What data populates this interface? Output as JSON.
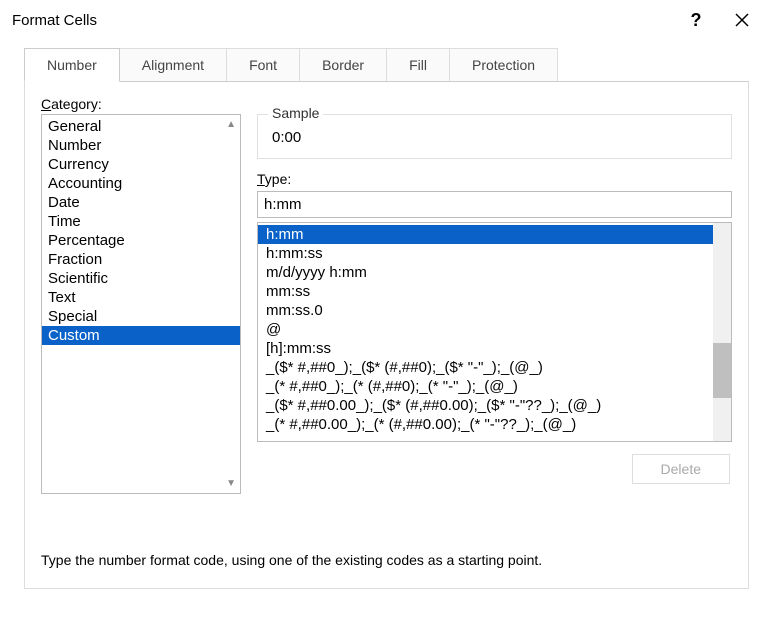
{
  "titlebar": {
    "title": "Format Cells"
  },
  "tabs": {
    "number": "Number",
    "alignment": "Alignment",
    "font": "Font",
    "border": "Border",
    "fill": "Fill",
    "protection": "Protection"
  },
  "category": {
    "label_u": "C",
    "label_rest": "ategory:",
    "items": {
      "general": "General",
      "number": "Number",
      "currency": "Currency",
      "accounting": "Accounting",
      "date": "Date",
      "time": "Time",
      "percentage": "Percentage",
      "fraction": "Fraction",
      "scientific": "Scientific",
      "text": "Text",
      "special": "Special",
      "custom": "Custom"
    }
  },
  "sample": {
    "legend": "Sample",
    "value": "0:00"
  },
  "type": {
    "label_u": "T",
    "label_rest": "ype:",
    "input": "h:mm",
    "items": {
      "i0": "h:mm",
      "i1": "h:mm:ss",
      "i2": "m/d/yyyy h:mm",
      "i3": "mm:ss",
      "i4": "mm:ss.0",
      "i5": "@",
      "i6": "[h]:mm:ss",
      "i7": "_($* #,##0_);_($* (#,##0);_($* \"-\"_);_(@_)",
      "i8": "_(* #,##0_);_(* (#,##0);_(* \"-\"_);_(@_)",
      "i9": "_($* #,##0.00_);_($* (#,##0.00);_($* \"-\"??_);_(@_)",
      "i10": "_(* #,##0.00_);_(* (#,##0.00);_(* \"-\"??_);_(@_)"
    }
  },
  "delete_btn": "Delete",
  "hint": "Type the number format code, using one of the existing codes as a starting point."
}
